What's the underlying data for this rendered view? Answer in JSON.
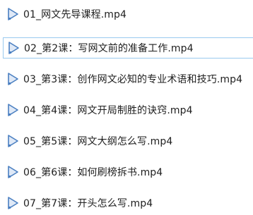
{
  "files": [
    {
      "name": "01_网文先导课程.mp4",
      "icon": "video-file-icon",
      "selected": false
    },
    {
      "name": "02_第2课：写网文前的准备工作.mp4",
      "icon": "video-file-icon",
      "selected": true
    },
    {
      "name": "03_第3课：创作网文必知的专业术语和技巧.mp4",
      "icon": "video-file-icon",
      "selected": false
    },
    {
      "name": "04_第4课：网文开局制胜的诀窍.mp4",
      "icon": "video-file-icon",
      "selected": false
    },
    {
      "name": "05_第5课：网文大纲怎么写.mp4",
      "icon": "video-file-icon",
      "selected": false
    },
    {
      "name": "06_第6课：如何刷榜拆书.mp4",
      "icon": "video-file-icon",
      "selected": false
    },
    {
      "name": "07_第7课：开头怎么写.mp4",
      "icon": "video-file-icon",
      "selected": false
    }
  ],
  "colors": {
    "icon_fill": "#dfe9f7",
    "icon_stroke": "#4a7fc1",
    "selection_border": "#99c9ef",
    "text": "#1e1e1e"
  }
}
